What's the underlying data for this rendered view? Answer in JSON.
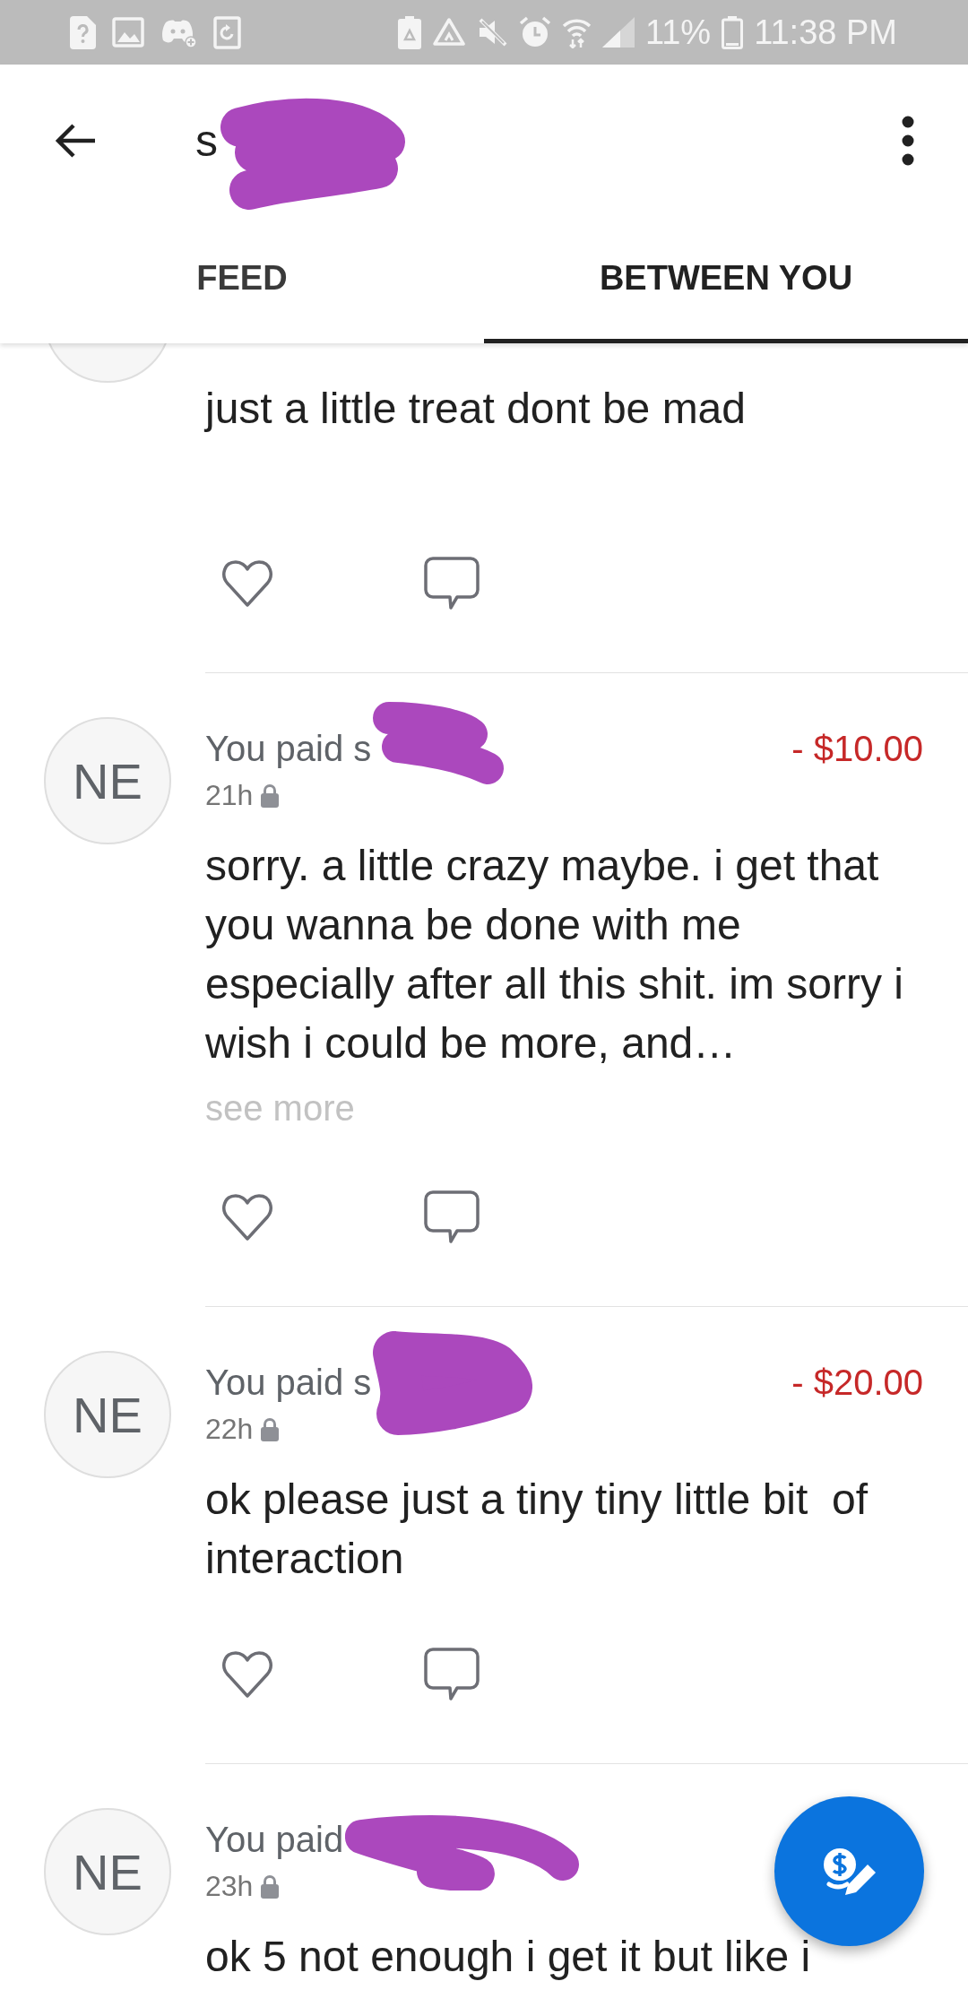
{
  "status_bar": {
    "battery_text": "11%",
    "time": "11:38 PM"
  },
  "header": {
    "title": "s",
    "title_redacted": true
  },
  "tabs": [
    {
      "label": "FEED",
      "selected": false
    },
    {
      "label": "BETWEEN YOU",
      "selected": true
    }
  ],
  "posts": [
    {
      "body": "just a little treat dont be mad",
      "liked": false
    },
    {
      "avatar": "NE",
      "summary": "You paid s",
      "redacted": true,
      "time": "21h",
      "private": true,
      "amount": "- $10.00",
      "body": "sorry. a little crazy maybe. i get that you wanna be done with me especially after all this shit. im sorry i wish i could be more, and…",
      "see_more": "see more",
      "liked": false
    },
    {
      "avatar": "NE",
      "summary": "You paid s",
      "redacted": true,
      "time": "22h",
      "private": true,
      "amount": "- $20.00",
      "body": "ok please just a tiny tiny little bit  of interaction",
      "liked": false
    },
    {
      "avatar": "NE",
      "summary": "You paid",
      "redacted": true,
      "time": "23h",
      "private": true,
      "body": "ok 5 not enough i get it but like i"
    }
  ]
}
